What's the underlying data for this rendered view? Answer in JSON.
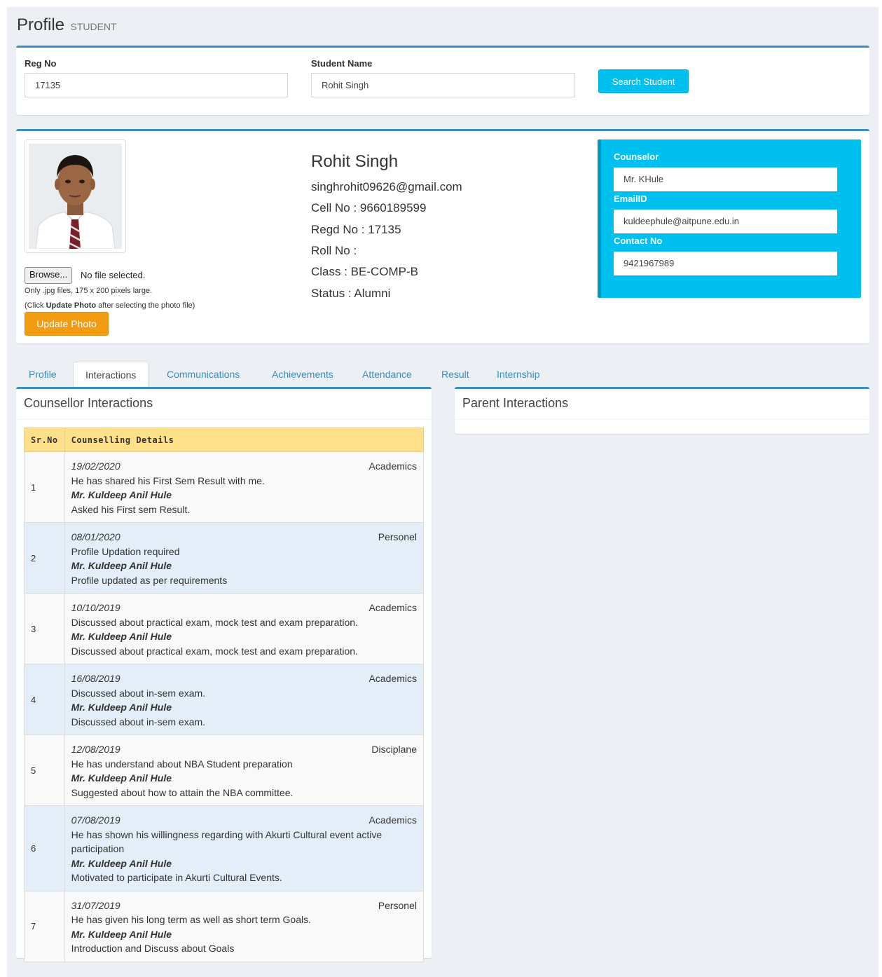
{
  "header": {
    "title": "Profile",
    "subtitle": "STUDENT"
  },
  "search": {
    "reg_label": "Reg No",
    "reg_value": "17135",
    "name_label": "Student Name",
    "name_value": "Rohit Singh",
    "button_label": "Search Student"
  },
  "profile": {
    "name": "Rohit Singh",
    "email": "singhrohit09626@gmail.com",
    "cell": "Cell No : 9660189599",
    "regd": "Regd No : 17135",
    "roll": "Roll No :",
    "class": "Class : BE-COMP-B",
    "status": "Status : Alumni",
    "photo_icon": "student-photo",
    "browse_label": "Browse...",
    "no_file": "No file selected.",
    "hint_size": "Only .jpg files, 175 x 200 pixels large.",
    "hint_click_prefix": "(Click ",
    "hint_click_bold": "Update Photo",
    "hint_click_suffix": " after selecting the photo file)",
    "update_button": "Update Photo"
  },
  "counselor": {
    "counselor_label": "Counselor",
    "counselor_value": "Mr. KHule",
    "email_label": "EmailID",
    "email_value": "kuldeephule@aitpune.edu.in",
    "contact_label": "Contact No",
    "contact_value": "9421967989"
  },
  "tabs": [
    "Profile",
    "Interactions",
    "Communications",
    "Achievements",
    "Attendance",
    "Result",
    "Internship"
  ],
  "counsellor_interactions": {
    "title": "Counsellor Interactions",
    "headers": [
      "Sr.No",
      "Counselling Details"
    ],
    "rows": [
      {
        "no": "1",
        "date": "19/02/2020",
        "category": "Academics",
        "lines": [
          "He has shared his First Sem Result with me."
        ],
        "by": "Mr. Kuldeep Anil Hule",
        "action": "Asked his First sem Result."
      },
      {
        "no": "2",
        "date": "08/01/2020",
        "category": "Personel",
        "lines": [
          "Profile Updation required"
        ],
        "by": "Mr. Kuldeep Anil Hule",
        "action": "Profile updated as per requirements"
      },
      {
        "no": "3",
        "date": "10/10/2019",
        "category": "Academics",
        "lines": [
          "Discussed about practical exam, mock test and exam preparation."
        ],
        "by": "Mr. Kuldeep Anil Hule",
        "action": "Discussed about practical exam, mock test and exam preparation."
      },
      {
        "no": "4",
        "date": "16/08/2019",
        "category": "Academics",
        "lines": [
          "Discussed about in-sem exam."
        ],
        "by": "Mr. Kuldeep Anil Hule",
        "action": "Discussed about in-sem exam."
      },
      {
        "no": "5",
        "date": "12/08/2019",
        "category": "Disciplane",
        "lines": [
          "He has understand about NBA Student preparation"
        ],
        "by": "Mr. Kuldeep Anil Hule",
        "action": "Suggested about how to attain the NBA committee."
      },
      {
        "no": "6",
        "date": "07/08/2019",
        "category": "Academics",
        "lines": [
          "He has shown his willingness regarding with Akurti Cultural event active",
          "participation"
        ],
        "by": "Mr. Kuldeep Anil Hule",
        "action": "Motivated to participate in Akurti Cultural Events."
      },
      {
        "no": "7",
        "date": "31/07/2019",
        "category": "Personel",
        "lines": [
          "He has given his long term as well as short term Goals."
        ],
        "by": "Mr. Kuldeep Anil Hule",
        "action": "Introduction and Discuss about Goals"
      }
    ]
  },
  "parent_interactions": {
    "title": "Parent Interactions"
  },
  "colors": {
    "accent": "#3c8dbc",
    "info": "#00c0ef",
    "warning": "#f39c12",
    "table_header": "#ffe08a"
  }
}
